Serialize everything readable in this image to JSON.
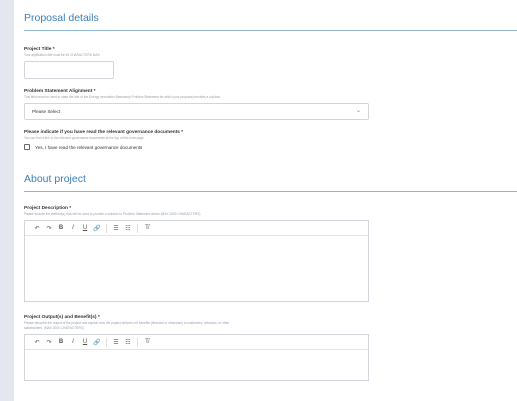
{
  "proposal_section": {
    "title": "Proposal details",
    "project_title": {
      "label": "Project Title *",
      "hint": "Your application title must be 45 CHARACTERS MAX",
      "value": ""
    },
    "alignment": {
      "label": "Problem Statement Alignment *",
      "hint": "This field must be used to state the title of the Energy Innovation Basecamp Problem Statement for which your proposal provides a solution",
      "selected": "Please Select"
    },
    "governance": {
      "label": "Please indicate if you have read the relevant governance documents *",
      "hint": "You can find a link to the relevant governance documents at the top of this form page",
      "checkbox_label": "Yes, I have read the relevant governance documents"
    }
  },
  "about_section": {
    "title": "About project",
    "description": {
      "label": "Project Description *",
      "hint": "Please include the method(s) that will be used to provide a solution to Problem Statement above (MAX 2000 CHARACTERS)"
    },
    "outputs": {
      "label": "Project Output(s) and Benefit(s) *",
      "hint_line1": "Please describe the output of the project and explain how the project delivers net benefits (financial or otherwise) to customers, networks, or other",
      "hint_line2": "stakeholders. (MAX 2000 CHARACTERS)"
    }
  },
  "toolbar": {
    "undo": "↶",
    "redo": "↷",
    "bold": "B",
    "italic": "I",
    "underline": "U",
    "link": "🔗",
    "bullet_list": "☰",
    "numbered_list": "☷",
    "clear_format": "T̸"
  },
  "icons": {
    "chevron": "⌄"
  }
}
